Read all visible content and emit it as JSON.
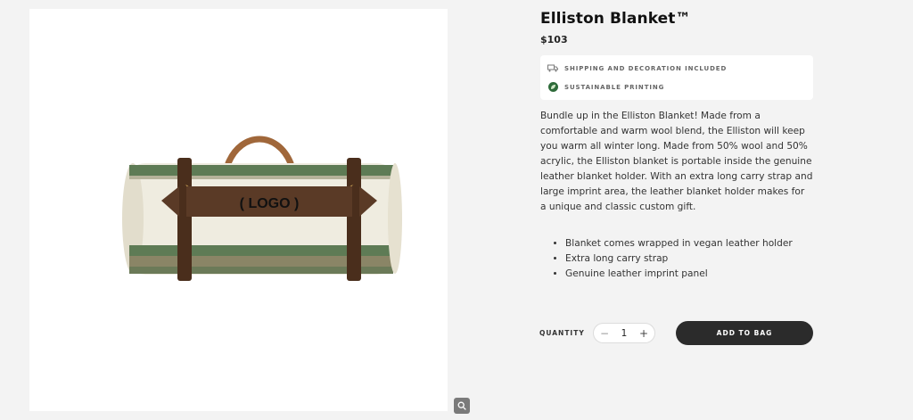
{
  "product": {
    "title": "Elliston Blanket™",
    "price": "$103",
    "image_alt": "Elliston Blanket rolled in leather holder",
    "logo_placeholder": "( LOGO )",
    "perks": [
      {
        "icon": "truck-icon",
        "label": "SHIPPING AND DECORATION INCLUDED"
      },
      {
        "icon": "leaf-icon",
        "label": "SUSTAINABLE PRINTING"
      }
    ],
    "description": "Bundle up in the Elliston Blanket! Made from a comfortable and warm wool blend, the Elliston will keep you warm all winter long. Made from 50% wool and 50% acrylic, the Elliston blanket is portable inside the genuine leather blanket holder. With an extra long carry strap and large imprint area, the leather blanket holder makes for a unique and classic custom gift.",
    "features": [
      "Blanket comes wrapped in vegan leather holder",
      "Extra long carry strap",
      "Genuine leather imprint panel"
    ]
  },
  "purchase": {
    "quantity_label": "QUANTITY",
    "quantity": "1",
    "minus": "−",
    "plus": "+",
    "add_to_bag": "ADD TO BAG"
  },
  "colors": {
    "background": "#f3f3f3",
    "button": "#2b2b2b",
    "leaf": "#2e6b3a",
    "stripe": "#5e7b55",
    "leather": "#5a3a26"
  }
}
